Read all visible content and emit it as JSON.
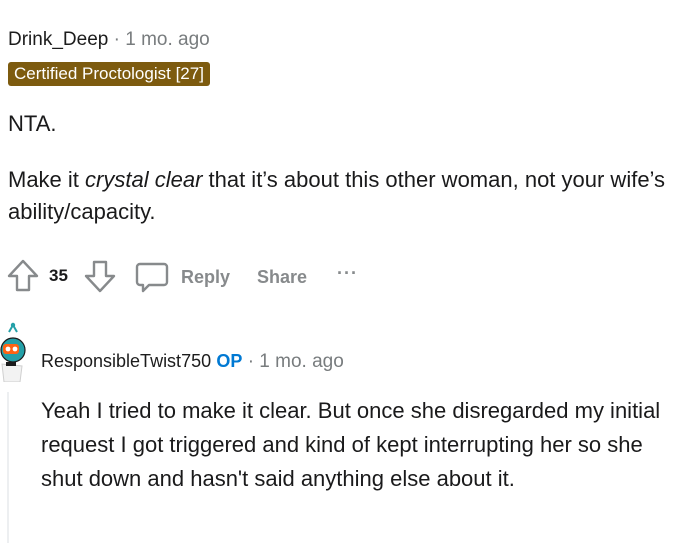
{
  "comment1": {
    "username": "Drink_Deep",
    "separator": "·",
    "time": "1 mo. ago",
    "flair": "Certified Proctologist [27]",
    "paragraph1": "NTA.",
    "paragraph2_pre": "Make it ",
    "paragraph2_em": "crystal clear",
    "paragraph2_post": " that it’s about this other woman, not your wife’s ability/capacity.",
    "votes": "35",
    "reply_label": "Reply",
    "share_label": "Share",
    "more_label": "···"
  },
  "comment2": {
    "username": "ResponsibleTwist750",
    "op_badge": "OP",
    "separator": "·",
    "time": "1 mo. ago",
    "body": "Yeah I tried to make it clear. But once she disregarded my initial request I got triggered and kind of kept interrupting her so she shut down and hasn't said anything else about it."
  },
  "colors": {
    "flair_bg": "#7d5b0f",
    "op_blue": "#0079d3",
    "muted": "#878a8c",
    "avatar_teal": "#24a0a8",
    "avatar_orange": "#ff6314"
  }
}
